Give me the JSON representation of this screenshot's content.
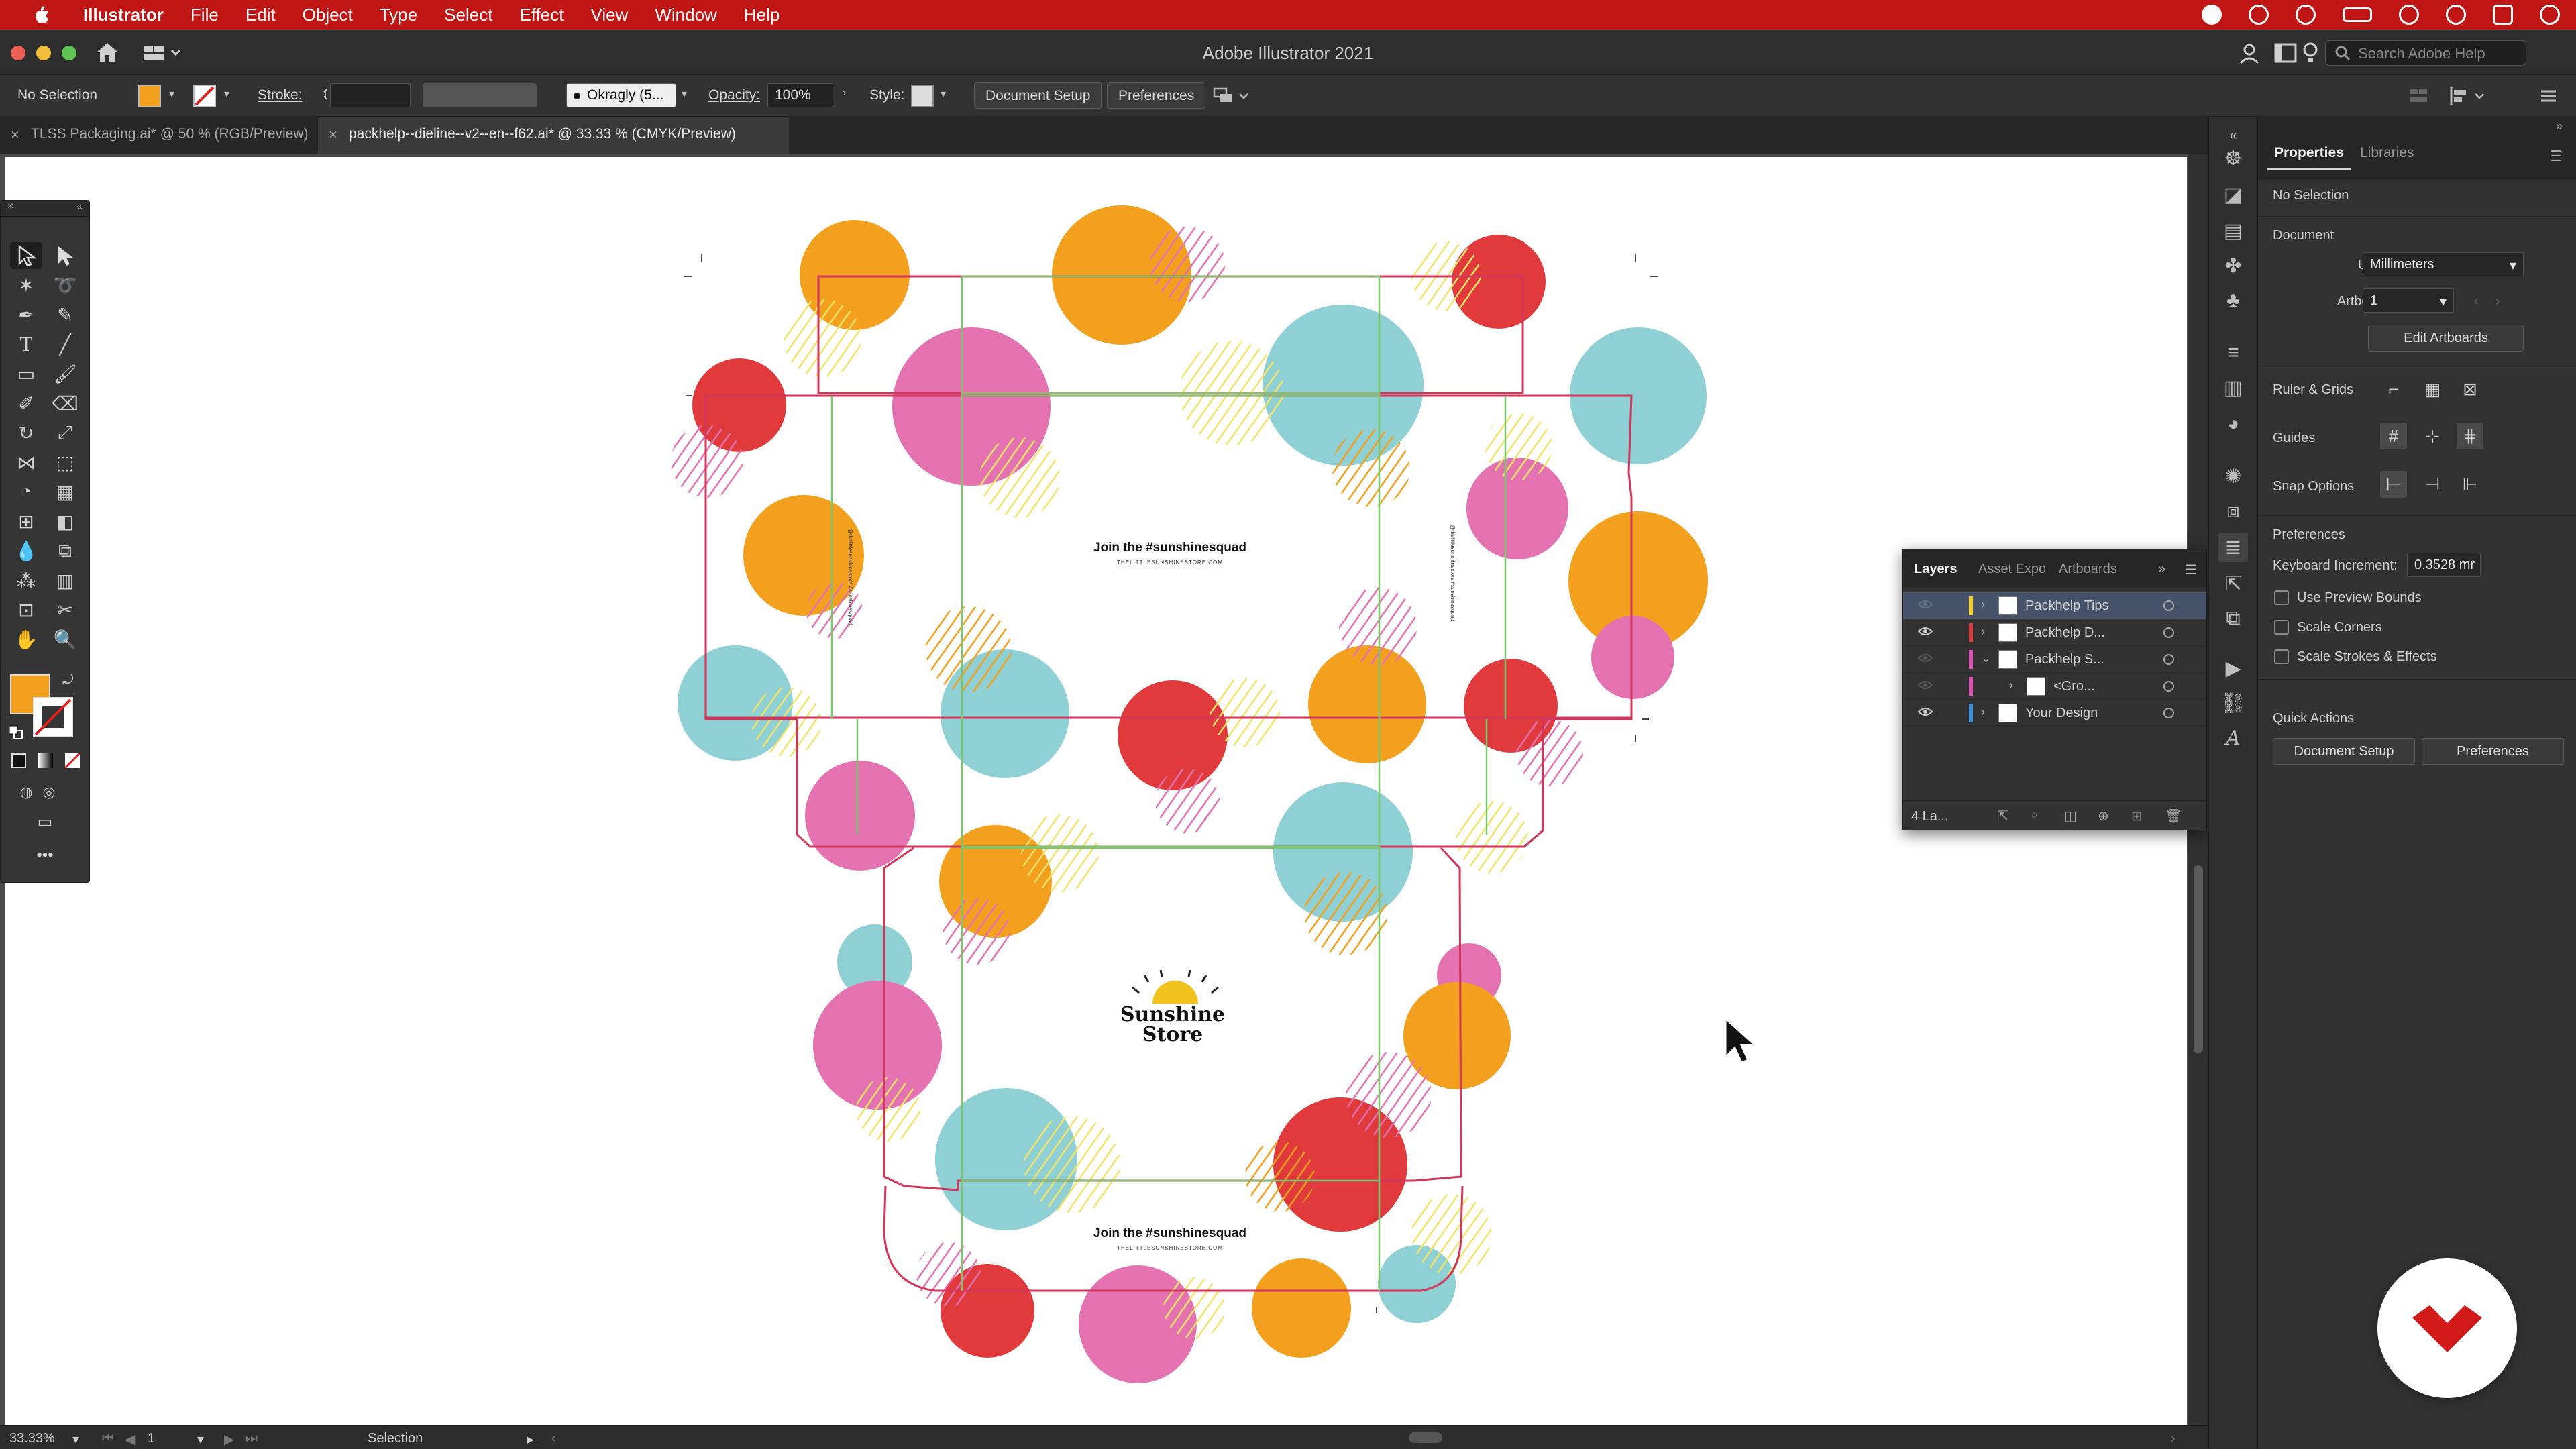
{
  "menubar": {
    "app_name": "Illustrator",
    "items": [
      "File",
      "Edit",
      "Object",
      "Type",
      "Select",
      "Effect",
      "View",
      "Window",
      "Help"
    ]
  },
  "titlebar": {
    "title": "Adobe Illustrator 2021",
    "search_placeholder": "Search Adobe Help"
  },
  "controlbar": {
    "selection_status": "No Selection",
    "stroke_label": "Stroke:",
    "brush_name": "Okragly (5...",
    "opacity_label": "Opacity:",
    "opacity_value": "100%",
    "style_label": "Style:",
    "document_setup": "Document Setup",
    "preferences": "Preferences",
    "fill_color": "#f2a01e"
  },
  "tabs": [
    {
      "label": "TLSS Packaging.ai* @ 50 % (RGB/Preview)",
      "active": false
    },
    {
      "label": "packhelp--dieline--v2--en--f62.ai* @ 33.33 % (CMYK/Preview)",
      "active": true
    }
  ],
  "artwork": {
    "headline_1": "Join the #sunshinesquad",
    "website_1": "THELITTLESUNSHINESTORE.COM",
    "headline_2": "Join the #sunshinesquad",
    "website_2": "THELITTLESUNSHINESTORE.COM",
    "logo_line1": "Sunshine",
    "logo_line2": "Store",
    "side_text_left": "@thelittlesunshinestore #sunshinesquad",
    "side_text_right": "@thelittlesunshinestore #sunshinesquad",
    "colors": {
      "orange": "#f2a01e",
      "pink": "#e472b1",
      "red": "#e03a3c",
      "teal": "#8ed0d4",
      "yellow": "#f4e36a",
      "dieline_red": "#d2365a",
      "dieline_green": "#7cc66c"
    }
  },
  "statusbar": {
    "zoom": "33.33%",
    "artboard_number": "1",
    "tool_name": "Selection"
  },
  "properties": {
    "tabs": [
      "Properties",
      "Libraries"
    ],
    "selection": "No Selection",
    "document_heading": "Document",
    "units_label": "Units:",
    "units_value": "Millimeters",
    "artboard_label": "Artboard:",
    "artboard_value": "1",
    "edit_artboards": "Edit Artboards",
    "ruler_grids": "Ruler & Grids",
    "guides": "Guides",
    "snap_options": "Snap Options",
    "preferences_heading": "Preferences",
    "keyboard_increment_label": "Keyboard Increment:",
    "keyboard_increment_value": "0.3528 mr",
    "use_preview_bounds": "Use Preview Bounds",
    "scale_corners": "Scale Corners",
    "scale_strokes": "Scale Strokes & Effects",
    "quick_actions": "Quick Actions",
    "qa_document_setup": "Document Setup",
    "qa_preferences": "Preferences"
  },
  "layers_panel": {
    "tabs": [
      "Layers",
      "Asset Expo",
      "Artboards"
    ],
    "rows": [
      {
        "name": "Packhelp Tips",
        "color": "#f2d22a",
        "visible": false,
        "expanded": false,
        "indent": 0,
        "selected": true
      },
      {
        "name": "Packhelp D...",
        "color": "#d83a3a",
        "visible": true,
        "expanded": false,
        "indent": 0,
        "selected": false
      },
      {
        "name": "Packhelp S...",
        "color": "#d84fb0",
        "visible": false,
        "expanded": true,
        "indent": 0,
        "selected": false
      },
      {
        "name": "<Gro...",
        "color": "#d84fb0",
        "visible": false,
        "expanded": false,
        "indent": 1,
        "selected": false
      },
      {
        "name": "Your Design",
        "color": "#3a8fd8",
        "visible": true,
        "expanded": false,
        "indent": 0,
        "selected": false
      }
    ],
    "footer_count": "4 La..."
  }
}
